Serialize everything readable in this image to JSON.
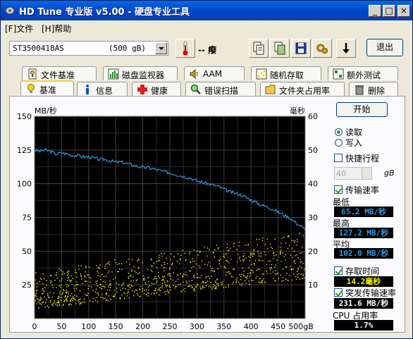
{
  "window": {
    "title": "HD Tune 专业版 v5.00 - 硬盘专业工具",
    "minimize_label": "_",
    "maximize_label": "□",
    "close_label": "×"
  },
  "menu": [
    "[F]文件",
    "[H]帮助"
  ],
  "toolbar": {
    "drive": "ST3500418AS",
    "capacity": "(500 gB)",
    "temperature": "-- 癈",
    "exit_label": "退出"
  },
  "tabs_top": [
    "文件基准",
    "磁盘监视器",
    "AAM",
    "随机存取",
    "额外测试"
  ],
  "tabs_bottom": [
    "基准",
    "信息",
    "健康",
    "错误扫描",
    "文件夹占用率",
    "删除"
  ],
  "side": {
    "start_label": "开始",
    "read_label": "读取",
    "write_label": "写入",
    "quick_label": "快捷行程",
    "quick_value": "40",
    "quick_unit": "gB",
    "transfer_label": "传输速率",
    "min_label": "最低",
    "min_value": "65.2 MB/秒",
    "max_label": "最高",
    "max_value": "127.2 MB/秒",
    "avg_label": "平均",
    "avg_value": "102.0 MB/秒",
    "access_label": "存取时间",
    "access_value": "14.2毫秒",
    "burst_label": "突发传输速率",
    "burst_value": "231.6 MB/秒",
    "cpu_label": "CPU 占用率",
    "cpu_value": "1.7%"
  },
  "colors": {
    "line": "#2A9BE0",
    "scatter": "#F0F000",
    "value_text_transfer": "#2A9BE0",
    "value_text_access": "#F0F000",
    "value_text_white": "#FFFFFF"
  },
  "chart_data": {
    "type": "line",
    "ylabel_left": "MB/秒",
    "ylabel_right": "毫秒",
    "xlabel_unit": "gB",
    "xlim": [
      0,
      500
    ],
    "ylim_left": [
      0,
      150
    ],
    "ylim_right": [
      0,
      60
    ],
    "x_ticks": [
      "0",
      "50",
      "100",
      "150",
      "200",
      "250",
      "300",
      "350",
      "400",
      "450",
      "500gB"
    ],
    "y_left_ticks": [
      "25",
      "50",
      "75",
      "100",
      "125",
      "150"
    ],
    "y_right_ticks": [
      "10",
      "20",
      "30",
      "40",
      "50",
      "60"
    ],
    "grid": true,
    "series": [
      {
        "name": "传输速率",
        "axis": "left",
        "x": [
          0,
          10,
          20,
          30,
          40,
          50,
          60,
          70,
          80,
          90,
          100,
          110,
          120,
          130,
          140,
          150,
          160,
          170,
          180,
          190,
          200,
          210,
          220,
          230,
          240,
          250,
          260,
          270,
          280,
          290,
          300,
          310,
          320,
          330,
          340,
          350,
          360,
          370,
          380,
          390,
          400,
          410,
          420,
          430,
          440,
          450,
          460,
          470,
          480,
          490,
          500
        ],
        "y": [
          125,
          124,
          125,
          124,
          122,
          123,
          122,
          121,
          121,
          120,
          120,
          119,
          118,
          118,
          117,
          116,
          116,
          115,
          114,
          113,
          112,
          112,
          111,
          110,
          109,
          108,
          107,
          106,
          105,
          104,
          102,
          101,
          100,
          99,
          98,
          96,
          94,
          93,
          92,
          90,
          88,
          86,
          84,
          83,
          81,
          79,
          77,
          75,
          72,
          69,
          66
        ]
      },
      {
        "name": "存取时间",
        "axis": "right",
        "type": "scatter",
        "x_range": [
          0,
          500
        ],
        "y_band_start": [
          3,
          14
        ],
        "y_band_end": [
          12,
          26
        ]
      }
    ]
  }
}
